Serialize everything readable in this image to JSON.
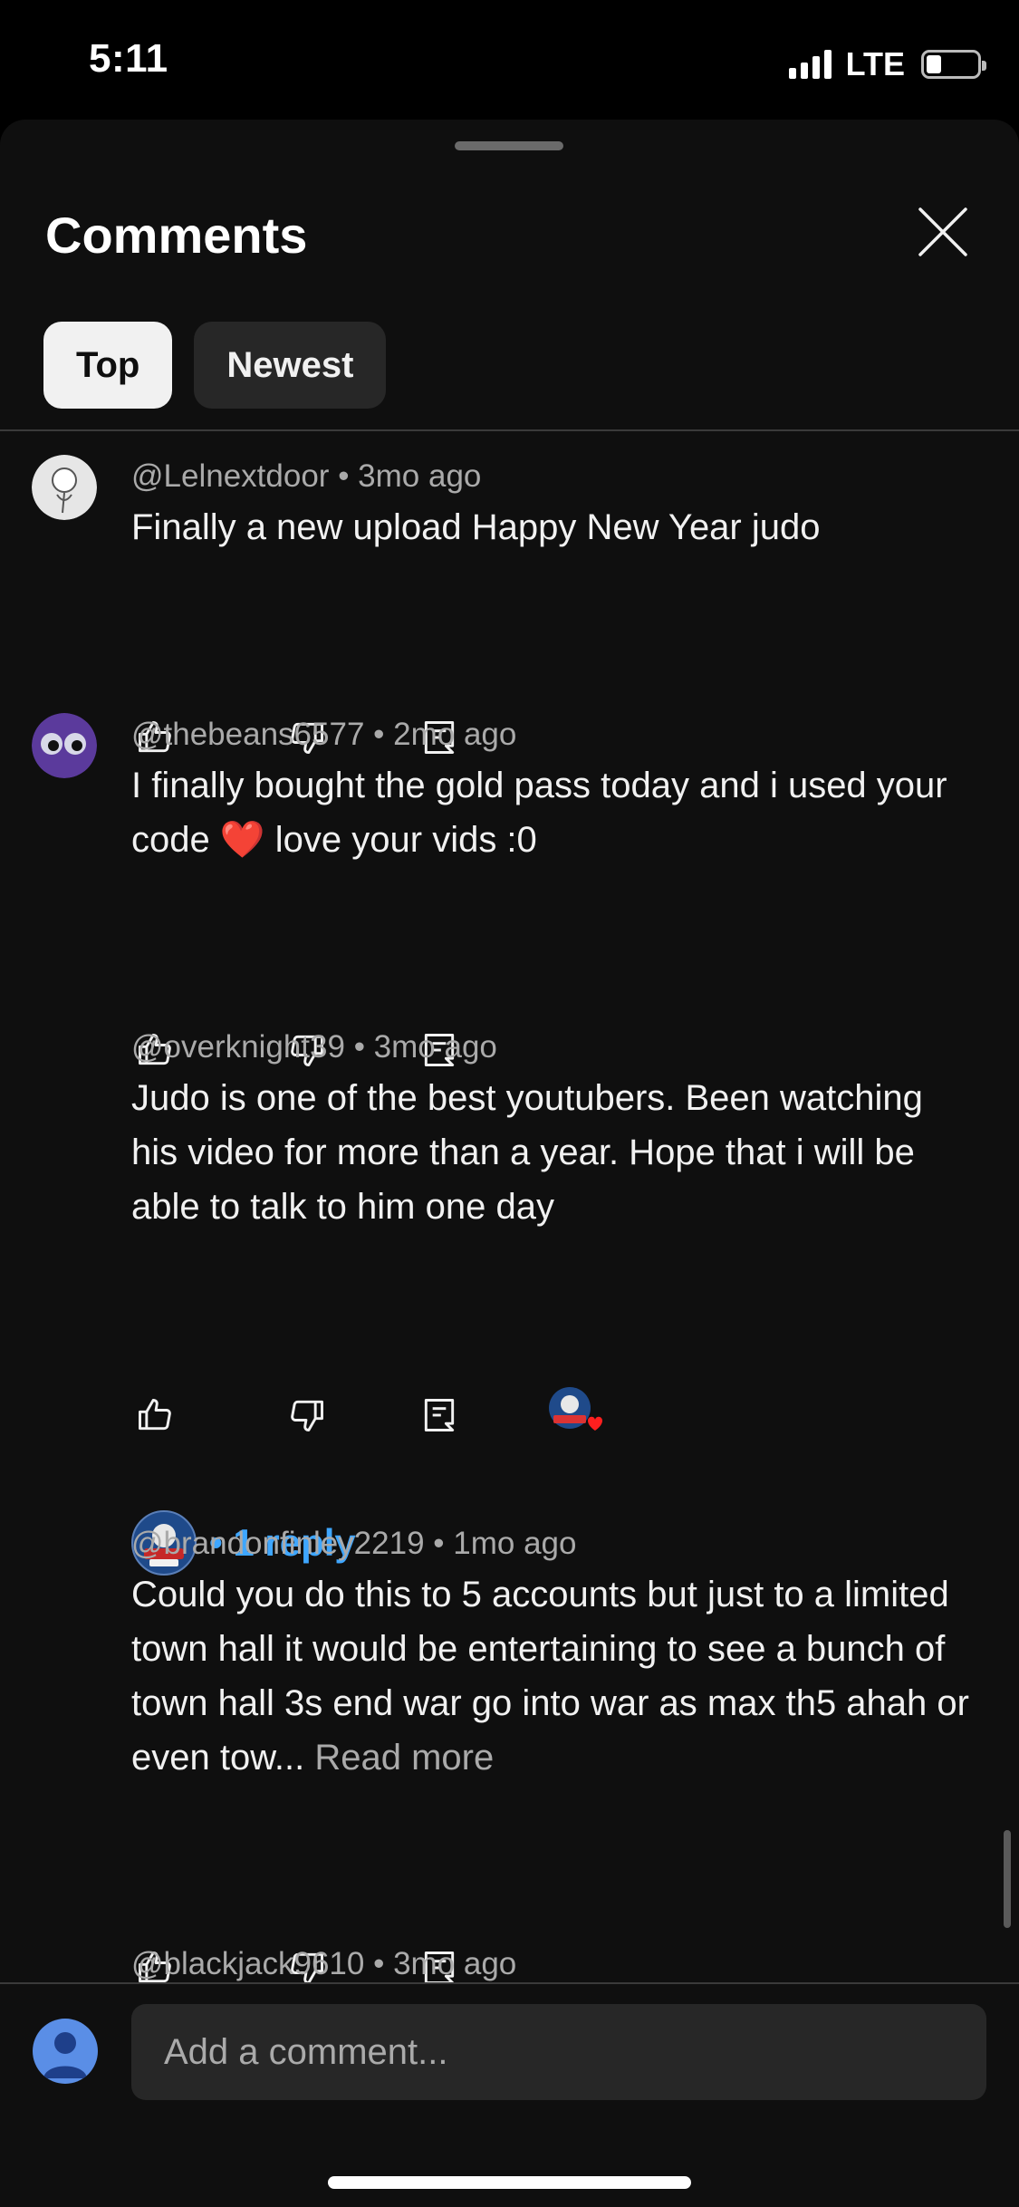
{
  "status_bar": {
    "time": "5:11",
    "network": "LTE"
  },
  "sheet": {
    "title": "Comments"
  },
  "tabs": [
    {
      "label": "Top",
      "active": true
    },
    {
      "label": "Newest",
      "active": false
    }
  ],
  "comments": [
    {
      "author": "@Lelnextdoor",
      "age": "3mo ago",
      "text": "Finally a new upload Happy New Year judo"
    },
    {
      "author": "@thebeans6577",
      "age": "2mo ago",
      "text": "I finally bought the gold pass today and i used your code ❤️ love your vids :0"
    },
    {
      "author": "@overknight39",
      "age": "3mo ago",
      "text": "Judo is one of the best youtubers. Been watching his video for more than a year. Hope that i will be able to talk to him one day",
      "replies_label": "1 reply"
    },
    {
      "author": "@brandonfinley2219",
      "age": "1mo ago",
      "text": "Could you do this to 5 accounts but just to a limited town hall it would be entertaining to see a bunch of town hall 3s end war go into war as max th5 ahah or even tow...",
      "read_more": "Read more"
    },
    {
      "author": "@blackjack9610",
      "age": "3mo ago"
    }
  ],
  "footer": {
    "placeholder": "Add a comment..."
  },
  "colors": {
    "background": "#0f0f0f",
    "text": "#f1f1f1",
    "secondary_text": "#aaaaaa",
    "link": "#3ea6ff",
    "heart": "#ff1f1f"
  },
  "icons": [
    "close-icon",
    "like-icon",
    "dislike-icon",
    "reply-icon",
    "creator-heart-icon"
  ]
}
